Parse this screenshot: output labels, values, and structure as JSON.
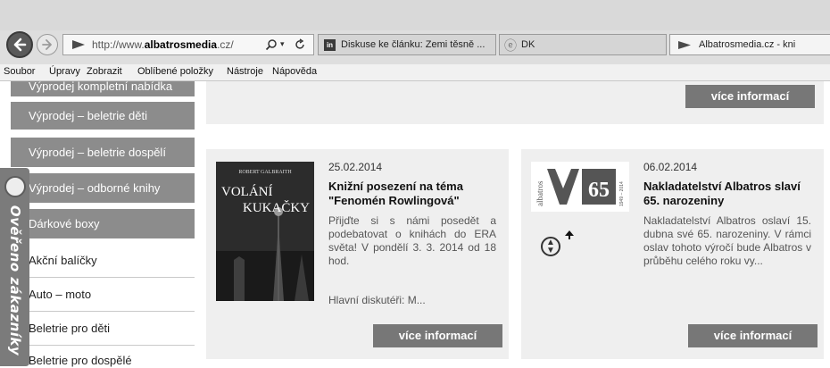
{
  "browser": {
    "url_prefix": "http://www.",
    "url_domain": "albatrosmedia",
    "url_suffix": ".cz/",
    "tabs": [
      {
        "label": "Diskuse ke článku: Zemi těsně ..."
      },
      {
        "label": "DK"
      },
      {
        "label": "Albatrosmedia.cz - kni"
      }
    ],
    "menu": [
      "Soubor",
      "Úpravy",
      "Zobrazit",
      "Oblíbené položky",
      "Nástroje",
      "Nápověda"
    ]
  },
  "sidebar": {
    "items": [
      {
        "label": "Výprodej kompletní nabídka"
      },
      {
        "label": "Výprodej – beletrie děti"
      },
      {
        "label": "Výprodej – beletrie dospělí"
      },
      {
        "label": "Výprodej – odborné knihy"
      },
      {
        "label": "Dárkové boxy"
      },
      {
        "label": "Akční balíčky"
      },
      {
        "label": "Auto – moto"
      },
      {
        "label": "Beletrie pro děti"
      },
      {
        "label": "Beletrie pro dospělé"
      }
    ],
    "badge_text": "Ověřeno zákazníky"
  },
  "top_panel": {
    "button_label": "více informací"
  },
  "articles": [
    {
      "date": "25.02.2014",
      "title": "Knižní posezení na téma \"Fenomén Rowlingová\"",
      "text": "Přijďte si s námi posedět a podebatovat o knihách do ERA světa! V pondělí 3. 3. 2014 od 18 hod.",
      "extra": "Hlavní diskutéři: M...",
      "button_label": "více informací",
      "cover_author": "ROBERT GALBRAITH",
      "cover_title_1": "VOLÁNÍ",
      "cover_title_2": "KUKAČKY"
    },
    {
      "date": "06.02.2014",
      "title": "Nakladatelství Albatros slaví 65. narozeniny",
      "text": "Nakladatelství Albatros oslaví 15. dubna své 65. narozeniny. V rámci oslav tohoto výročí bude Albatros v průběhu celého roku vy...",
      "button_label": "více informací",
      "logo_vertical": "albatros",
      "logo_number": "65",
      "logo_years": "1949 – 2014"
    }
  ],
  "colors": {
    "button": "#777777",
    "sidebar_active": "#8c8c8c",
    "panel": "#efefef"
  }
}
